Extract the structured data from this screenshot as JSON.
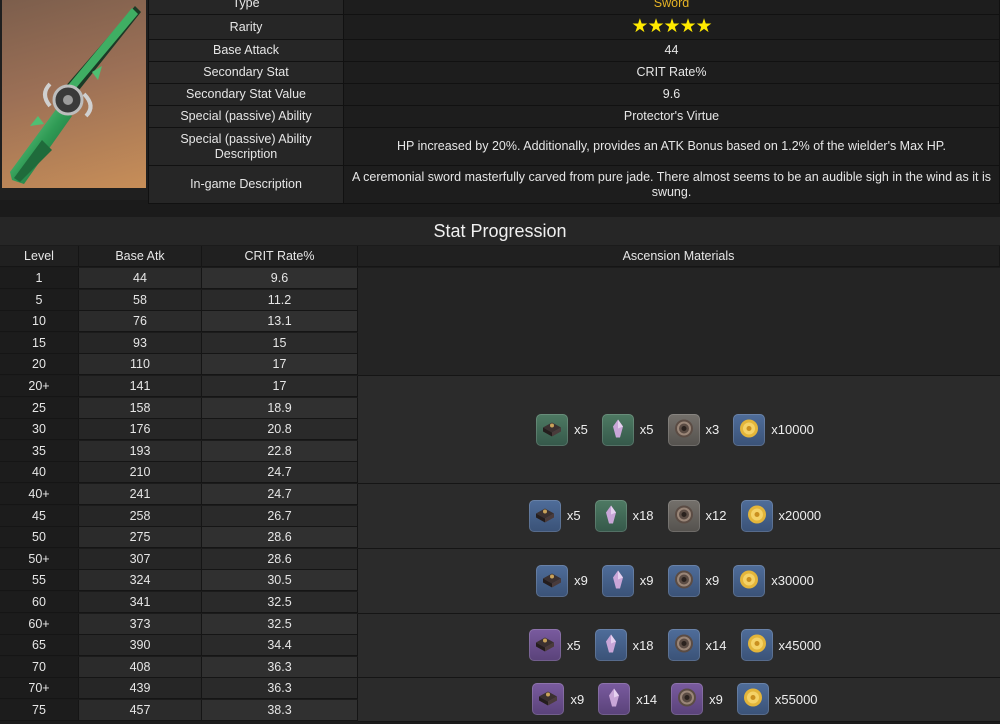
{
  "info": {
    "rows": [
      {
        "label": "Type",
        "value": "Sword"
      },
      {
        "label": "Rarity",
        "value": "★★★★★"
      },
      {
        "label": "Base Attack",
        "value": "44"
      },
      {
        "label": "Secondary Stat",
        "value": "CRIT Rate%"
      },
      {
        "label": "Secondary Stat Value",
        "value": "9.6"
      },
      {
        "label": "Special (passive) Ability",
        "value": "Protector's Virtue"
      },
      {
        "label": "Special (passive) Ability Description",
        "value": "HP increased by 20%. Additionally, provides an ATK Bonus based on 1.2% of the wielder's Max HP."
      },
      {
        "label": "In-game Description",
        "value": "A ceremonial sword masterfully carved from pure jade. There almost seems to be an audible sigh in the wind as it is swung."
      }
    ],
    "rarity_stars": 5
  },
  "progression": {
    "title": "Stat Progression",
    "headers": [
      "Level",
      "Base Atk",
      "CRIT Rate%",
      "Ascension Materials"
    ],
    "rows": [
      [
        "1",
        "44",
        "9.6"
      ],
      [
        "5",
        "58",
        "11.2"
      ],
      [
        "10",
        "76",
        "13.1"
      ],
      [
        "15",
        "93",
        "15"
      ],
      [
        "20",
        "110",
        "17"
      ],
      [
        "20+",
        "141",
        "17"
      ],
      [
        "25",
        "158",
        "18.9"
      ],
      [
        "30",
        "176",
        "20.8"
      ],
      [
        "35",
        "193",
        "22.8"
      ],
      [
        "40",
        "210",
        "24.7"
      ],
      [
        "40+",
        "241",
        "24.7"
      ],
      [
        "45",
        "258",
        "26.7"
      ],
      [
        "50",
        "275",
        "28.6"
      ],
      [
        "50+",
        "307",
        "28.6"
      ],
      [
        "55",
        "324",
        "30.5"
      ],
      [
        "60",
        "341",
        "32.5"
      ],
      [
        "60+",
        "373",
        "32.5"
      ],
      [
        "65",
        "390",
        "34.4"
      ],
      [
        "70",
        "408",
        "36.3"
      ],
      [
        "70+",
        "439",
        "36.3"
      ],
      [
        "75",
        "457",
        "38.3"
      ]
    ],
    "materials": [
      {
        "rows": 5,
        "items": []
      },
      {
        "rows": 5,
        "items": [
          {
            "icon": "domain-material-icon",
            "color": "green",
            "count": "x5"
          },
          {
            "icon": "elite-drop-icon",
            "color": "green",
            "count": "x5"
          },
          {
            "icon": "common-drop-icon",
            "color": "gray",
            "count": "x3"
          },
          {
            "icon": "mora-coin-icon",
            "color": "blue",
            "count": "x10000"
          }
        ]
      },
      {
        "rows": 3,
        "items": [
          {
            "icon": "domain-material-icon",
            "color": "blue",
            "count": "x5"
          },
          {
            "icon": "elite-drop-icon",
            "color": "green",
            "count": "x18"
          },
          {
            "icon": "common-drop-icon",
            "color": "gray",
            "count": "x12"
          },
          {
            "icon": "mora-coin-icon",
            "color": "blue",
            "count": "x20000"
          }
        ]
      },
      {
        "rows": 3,
        "items": [
          {
            "icon": "domain-material-icon",
            "color": "blue",
            "count": "x9"
          },
          {
            "icon": "elite-drop-icon",
            "color": "blue",
            "count": "x9"
          },
          {
            "icon": "common-drop-icon",
            "color": "blue",
            "count": "x9"
          },
          {
            "icon": "mora-coin-icon",
            "color": "blue",
            "count": "x30000"
          }
        ]
      },
      {
        "rows": 3,
        "items": [
          {
            "icon": "domain-material-icon",
            "color": "purple",
            "count": "x5"
          },
          {
            "icon": "elite-drop-icon",
            "color": "blue",
            "count": "x18"
          },
          {
            "icon": "common-drop-icon",
            "color": "blue",
            "count": "x14"
          },
          {
            "icon": "mora-coin-icon",
            "color": "blue",
            "count": "x45000"
          }
        ]
      },
      {
        "rows": 2,
        "items": [
          {
            "icon": "domain-material-icon",
            "color": "purple",
            "count": "x9"
          },
          {
            "icon": "elite-drop-icon",
            "color": "purple",
            "count": "x14"
          },
          {
            "icon": "common-drop-icon",
            "color": "purple",
            "count": "x9"
          },
          {
            "icon": "mora-coin-icon",
            "color": "blue",
            "count": "x55000"
          }
        ]
      }
    ]
  },
  "colors": {
    "type_value": "#e6b325",
    "star": "#ffea00",
    "background": "#1b1b1b"
  }
}
